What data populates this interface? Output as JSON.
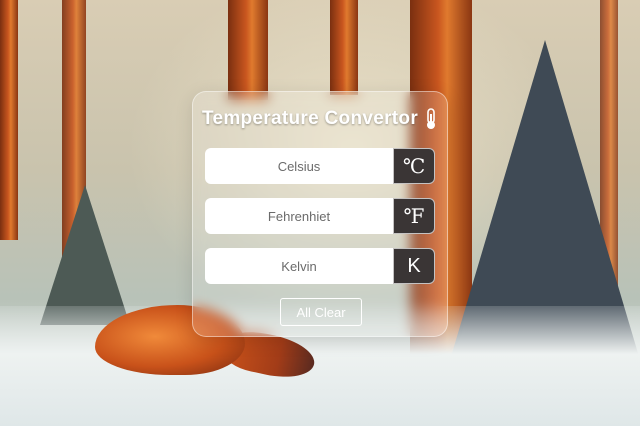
{
  "app": {
    "title": "Temperature Convertor",
    "title_icon": "thermometer-icon"
  },
  "fields": [
    {
      "placeholder": "Celsius",
      "value": "",
      "unit": "℃"
    },
    {
      "placeholder": "Fehrenhiet",
      "value": "",
      "unit": "℉"
    },
    {
      "placeholder": "Kelvin",
      "value": "",
      "unit": "K"
    }
  ],
  "actions": {
    "clear_label": "All Clear"
  },
  "colors": {
    "unit_bg": "#3a3535",
    "text_light": "#ffffff"
  }
}
